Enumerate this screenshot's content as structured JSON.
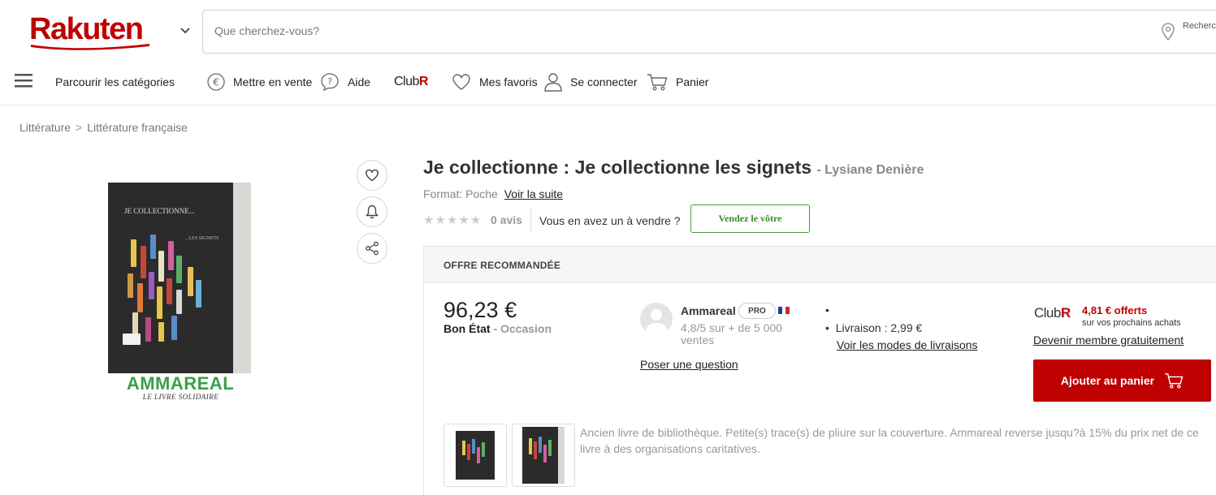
{
  "header": {
    "logo_text": "Rakuten",
    "search_placeholder": "Que cherchez-vous?",
    "search_location": "Recherc autour d"
  },
  "nav": {
    "categories": "Parcourir les catégories",
    "sell": "Mettre en vente",
    "help": "Aide",
    "club": "ClubR",
    "favorites": "Mes favoris",
    "login": "Se connecter",
    "cart": "Panier"
  },
  "breadcrumb": [
    "Littérature",
    "Littérature française"
  ],
  "product": {
    "title": "Je collectionne : Je collectionne les signets",
    "author": "- Lysiane Denière",
    "format_label": "Format: Poche",
    "format_link": "Voir la suite",
    "reviews": "0 avis",
    "sell_question": "Vous en avez un à vendre ?",
    "sell_button": "Vendez le vôtre",
    "image_brand": "AMMAREAL",
    "image_brand_sub": "LE LIVRE SOLIDAIRE",
    "cover_title": "JE COLLECTIONNE...",
    "cover_subtitle": "...LES SIGNETS"
  },
  "offer": {
    "header": "OFFRE RECOMMANDÉE",
    "price": "96,23 €",
    "condition": "Bon État",
    "condition_type": "- Occasion",
    "seller": "Ammareal",
    "seller_badge": "PRO",
    "seller_rating": "4,8/5 sur + de 5 000 ventes",
    "ask_question": "Poser une question",
    "delivery": "Livraison : 2,99 €",
    "delivery_link": "Voir les modes de livraisons",
    "club_label": "ClubR",
    "club_offer": "4,81 € offerts",
    "club_offer_sub": "sur vos prochains achats",
    "member_link": "Devenir membre gratuitement",
    "add_to_cart": "Ajouter au panier",
    "description": "Ancien livre de bibliothèque. Petite(s) trace(s) de pliure sur la couverture. Ammareal reverse jusqu?à 15% du prix net de ce livre à des organisations caritatives."
  },
  "colors": {
    "brand_red": "#bf0000",
    "ammareal_green": "#3aa04a",
    "sell_green": "#3a8a2a"
  }
}
